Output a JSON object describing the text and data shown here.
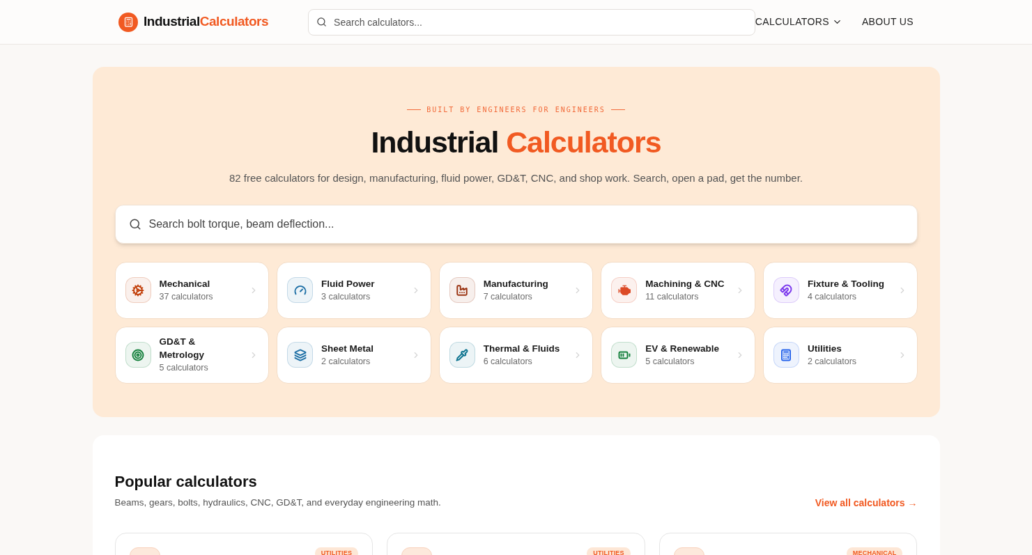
{
  "header": {
    "logo": {
      "first": "Industrial",
      "second": "Calculators"
    },
    "search": {
      "placeholder": "Search calculators..."
    },
    "nav": [
      {
        "label": "CALCULATORS",
        "kind": "dropdown"
      },
      {
        "label": "ABOUT US",
        "kind": "link"
      }
    ]
  },
  "hero": {
    "eyebrow": "BUILT BY ENGINEERS FOR ENGINEERS",
    "title": {
      "first": "Industrial",
      "second": "Calculators"
    },
    "subtitle": "82 free calculators for design, manufacturing, fluid power, GD&T, CNC, and shop work. Search, open a pad, get the number.",
    "search": {
      "placeholder": "Search bolt torque, beam deflection..."
    },
    "categories": [
      {
        "name": "Mechanical",
        "count": "37 calculators",
        "kind": "gears",
        "color": "#c2410c"
      },
      {
        "name": "Fluid Power",
        "count": "3 calculators",
        "kind": "gauge",
        "color": "#1d6fa5"
      },
      {
        "name": "Manufacturing",
        "count": "7 calculators",
        "kind": "factory",
        "color": "#9a3412"
      },
      {
        "name": "Machining & CNC",
        "count": "11 calculators",
        "kind": "engine",
        "color": "#dc4a26"
      },
      {
        "name": "Fixture & Tooling",
        "count": "4 calculators",
        "kind": "magnet",
        "color": "#7c3aed"
      },
      {
        "name": "GD&T & Metrology",
        "count": "5 calculators",
        "kind": "target",
        "color": "#15803d"
      },
      {
        "name": "Sheet Metal",
        "count": "2 calculators",
        "kind": "layers",
        "color": "#1d6fa5"
      },
      {
        "name": "Thermal & Fluids",
        "count": "6 calculators",
        "kind": "pipette",
        "color": "#0e7490"
      },
      {
        "name": "EV & Renewable",
        "count": "5 calculators",
        "kind": "battery",
        "color": "#15803d"
      },
      {
        "name": "Utilities",
        "count": "2 calculators",
        "kind": "calculator",
        "color": "#2563eb"
      }
    ]
  },
  "popular": {
    "title": "Popular calculators",
    "subtitle": "Beams, gears, bolts, hydraulics, CNC, GD&T, and everyday engineering math.",
    "view_all": "View all calculators →",
    "cards": [
      {
        "tag": "UTILITIES"
      },
      {
        "tag": "UTILITIES"
      },
      {
        "tag": "MECHANICAL"
      }
    ]
  }
}
